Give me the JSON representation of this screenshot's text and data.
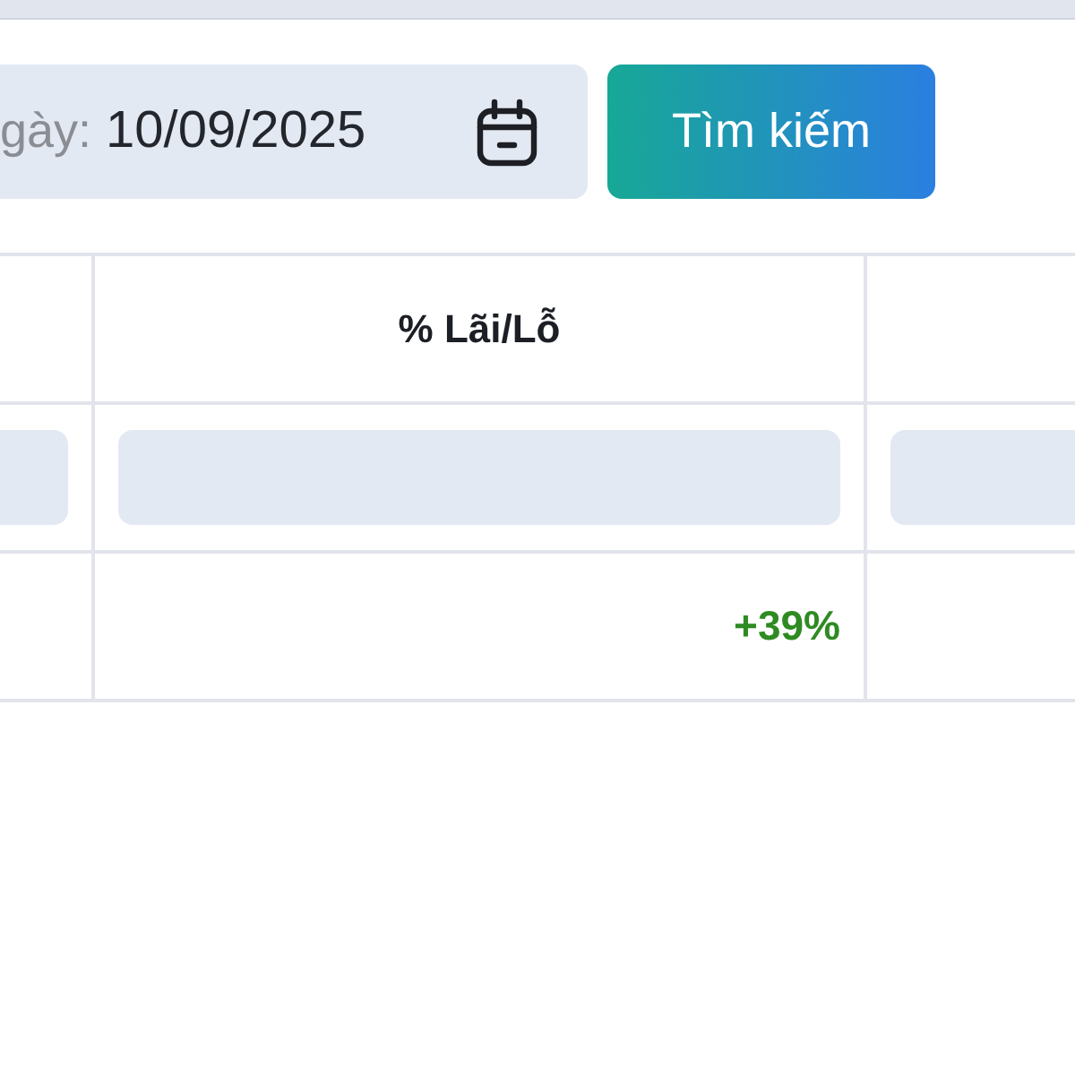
{
  "date_filter": {
    "label": "gày:",
    "value": "10/09/2025"
  },
  "search_button": {
    "label": "Tìm kiếm"
  },
  "table": {
    "columns": [
      {
        "kind": "blank"
      },
      {
        "kind": "text",
        "label": "% Lãi/Lỗ"
      },
      {
        "kind": "blank"
      }
    ],
    "rows": [
      {
        "cells": [
          null,
          {
            "text": "+39%",
            "color": "#2e8b22"
          },
          null
        ]
      }
    ]
  }
}
